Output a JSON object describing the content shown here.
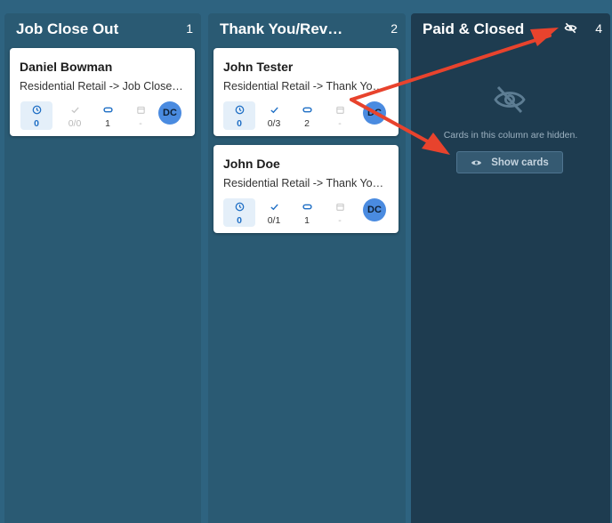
{
  "columns": [
    {
      "title": "Job Close Out",
      "count": "1",
      "cards": [
        {
          "name": "Daniel Bowman",
          "subtitle": "Residential Retail -> Job Close Out",
          "timer": "0",
          "tasks": "0/0",
          "attachments": "1",
          "date": "-",
          "avatar": "DC"
        }
      ]
    },
    {
      "title": "Thank You/Review",
      "count": "2",
      "cards": [
        {
          "name": "John Tester",
          "subtitle": "Residential Retail -> Thank You E",
          "timer": "0",
          "tasks": "0/3",
          "attachments": "2",
          "date": "-",
          "avatar": "DC"
        },
        {
          "name": "John Doe",
          "subtitle": "Residential Retail -> Thank You Email",
          "timer": "0",
          "tasks": "0/1",
          "attachments": "1",
          "date": "-",
          "avatar": "DC"
        }
      ]
    },
    {
      "title": "Paid & Closed",
      "count": "4",
      "hidden_message": "Cards in this column are hidden.",
      "show_cards_label": "Show cards"
    }
  ],
  "colors": {
    "board_bg": "#2e6380",
    "column_bg": "#2a5a73",
    "hidden_column_bg": "#1e3c50",
    "avatar_bg": "#4a8be0",
    "accent_blue": "#1f6fc5",
    "annotation_arrow": "#e8432d"
  },
  "icons": {
    "timer": "clock-icon",
    "tasks": "check-icon",
    "attachments": "paperclip-icon",
    "date": "calendar-icon",
    "hide": "eye-off-icon",
    "show": "eye-icon"
  }
}
